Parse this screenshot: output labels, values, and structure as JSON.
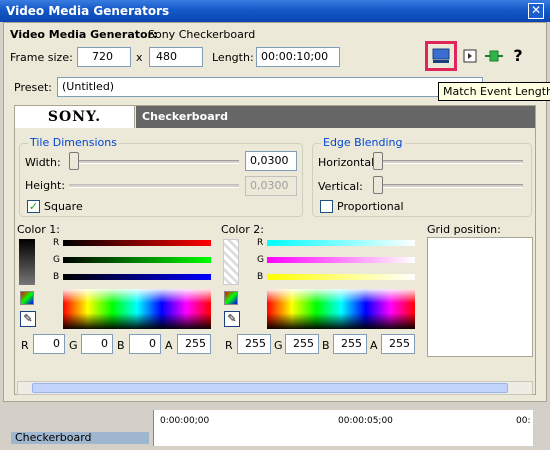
{
  "window": {
    "title": "Video Media Generators",
    "close_glyph": "✕"
  },
  "header": {
    "label": "Video Media Generator:",
    "name": "Sony Checkerboard",
    "frame_size_label": "Frame size:",
    "frame_width": "720",
    "times": "x",
    "frame_height": "480",
    "length_label": "Length:",
    "length_value": "00:00:10;00",
    "help_glyph": "?"
  },
  "icons": [
    "match-event-length-icon",
    "properties-icon",
    "plugin-chain-icon",
    "help-icon"
  ],
  "tooltip": "Match Event Length",
  "preset": {
    "label": "Preset:",
    "value": "(Untitled)"
  },
  "plugin": {
    "brand": "SONY.",
    "title": "Checkerboard"
  },
  "tile": {
    "title": "Tile Dimensions",
    "width_label": "Width:",
    "width_value": "0,0300",
    "height_label": "Height:",
    "height_value": "0,0300",
    "square_label": "Square",
    "square_checked": true
  },
  "edge": {
    "title": "Edge Blending",
    "horizontal_label": "Horizontal:",
    "vertical_label": "Vertical:",
    "proportional_label": "Proportional",
    "proportional_checked": false
  },
  "color1": {
    "title": "Color 1:",
    "r_label": "R",
    "g_label": "G",
    "b_label": "B",
    "a_label": "A",
    "r": "0",
    "g": "0",
    "b": "0",
    "a": "255"
  },
  "color2": {
    "title": "Color 2:",
    "r_label": "R",
    "g_label": "G",
    "b_label": "B",
    "a_label": "A",
    "r": "255",
    "g": "255",
    "b": "255",
    "a": "255"
  },
  "grid": {
    "title": "Grid position:"
  },
  "timeline": {
    "track_name": "Checkerboard",
    "ticks": [
      "0:00:00;00",
      "00:00:05;00",
      "00:"
    ]
  },
  "colors": {
    "accent": "#1458c8",
    "highlight": "#e0245c"
  }
}
